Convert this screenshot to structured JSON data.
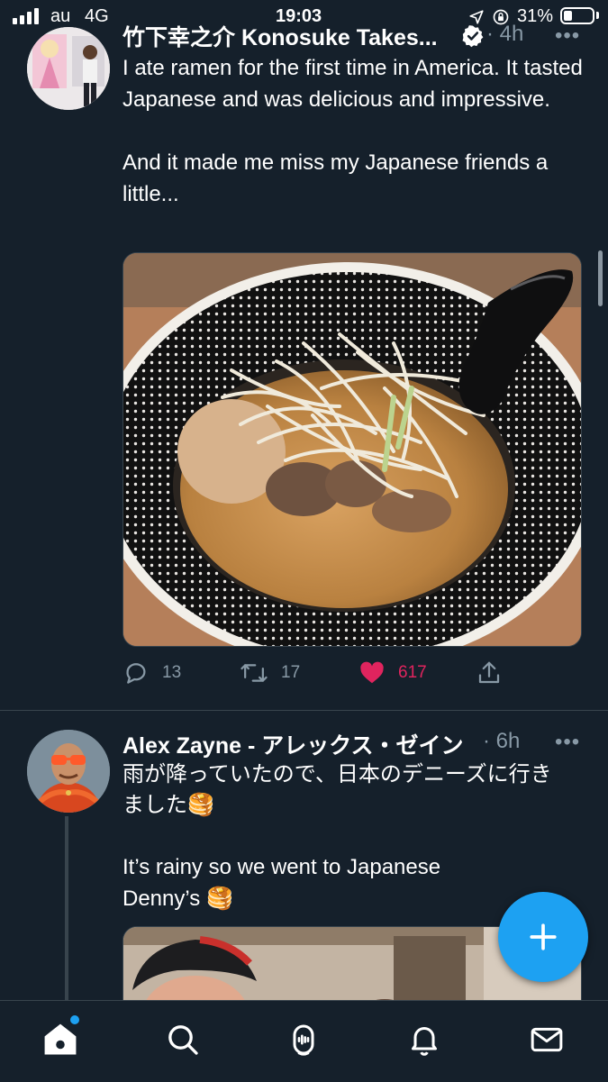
{
  "status_bar": {
    "carrier": "au",
    "network": "4G",
    "time": "19:03",
    "battery_percent": "31%",
    "battery_level": 0.31,
    "icons": [
      "signal-icon",
      "location-arrow-icon",
      "rotation-lock-icon",
      "battery-icon"
    ]
  },
  "tweets": [
    {
      "author": "竹下幸之介 Konosuke Takes...",
      "verified": true,
      "time": "· 4h",
      "text": "I ate ramen for the first time in America. It tasted Japanese and was delicious and impressive.\n\nAnd it made me miss my Japanese friends a little...",
      "actions": {
        "replies": "13",
        "retweets": "17",
        "likes": "617",
        "liked": true
      }
    },
    {
      "author": "Alex Zayne - アレックス・ゼイン",
      "time": "· 6h",
      "text_line1": "雨が降っていたので、日本のデニーズに行き",
      "text_line2": "ました🥞",
      "text_line3": "It’s rainy so we went to Japanese",
      "text_line4": "Denny’s 🥞"
    }
  ],
  "more_label": "•••",
  "tab_bar": {
    "tabs": [
      "home-icon",
      "search-icon",
      "spaces-icon",
      "notifications-icon",
      "messages-icon"
    ],
    "home_has_new": true
  },
  "fab_icon": "plus-icon",
  "colors": {
    "background": "#15202b",
    "divider": "#38444d",
    "secondary_text": "#8899a6",
    "accent": "#1da1f2",
    "like": "#e0245e"
  }
}
